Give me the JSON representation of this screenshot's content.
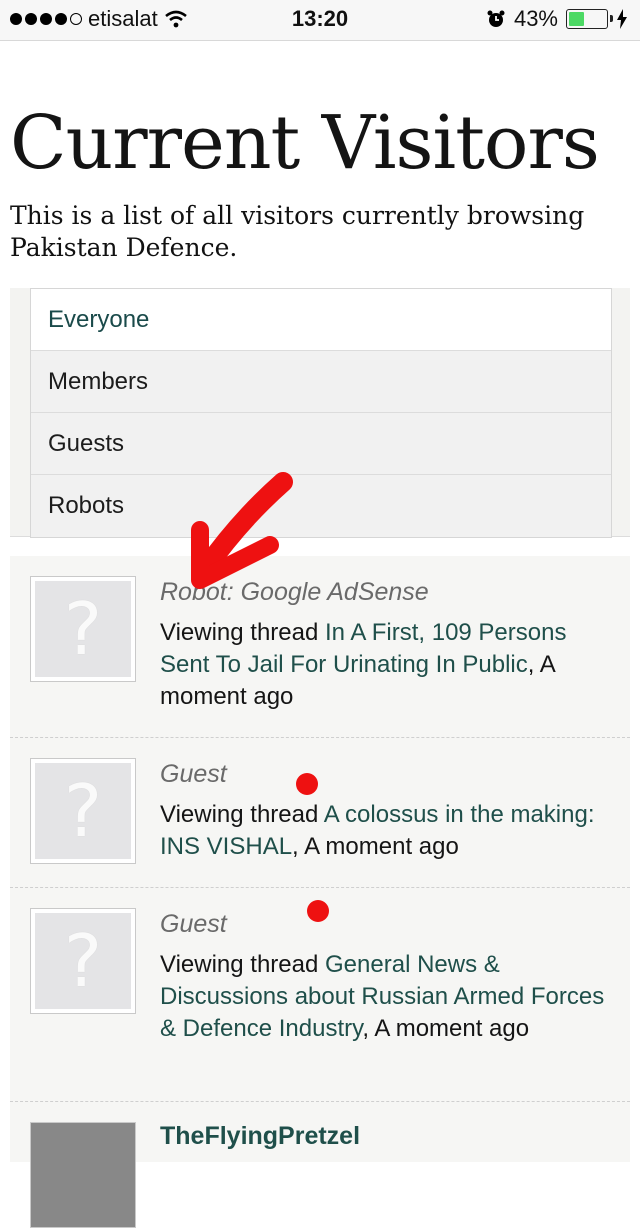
{
  "status_bar": {
    "carrier": "etisalat",
    "time": "13:20",
    "battery_percent": "43%",
    "battery_level": 0.43,
    "icons": [
      "signal-dots-icon",
      "wifi-icon",
      "alarm-icon",
      "battery-icon",
      "charging-bolt-icon"
    ]
  },
  "page": {
    "title": "Current Visitors",
    "description": "This is a list of all visitors currently browsing Pakistan Defence."
  },
  "filters": [
    {
      "label": "Everyone",
      "active": true
    },
    {
      "label": "Members",
      "active": false
    },
    {
      "label": "Guests",
      "active": false
    },
    {
      "label": "Robots",
      "active": false
    }
  ],
  "visitors": [
    {
      "name": "Robot: Google AdSense",
      "action": "Viewing thread",
      "thread": "In A First, 109 Persons Sent To Jail For Urinating In Public",
      "time": "A moment ago",
      "avatar_icon": "question-mark-icon"
    },
    {
      "name": "Guest",
      "action": "Viewing thread",
      "thread": "A colossus in the making: INS VISHAL",
      "time": "A moment ago",
      "avatar_icon": "question-mark-icon"
    },
    {
      "name": "Guest",
      "action": "Viewing thread",
      "thread": "General News & Discussions about Russian Armed Forces & Defence Industry",
      "time": "A moment ago",
      "avatar_icon": "question-mark-icon"
    },
    {
      "name": "TheFlyingPretzel"
    }
  ],
  "annotations": {
    "color": "#ee1111",
    "marks": [
      "red-arrow",
      "red-dot",
      "red-dot"
    ]
  },
  "avatar_glyph": "?",
  "separator": ","
}
